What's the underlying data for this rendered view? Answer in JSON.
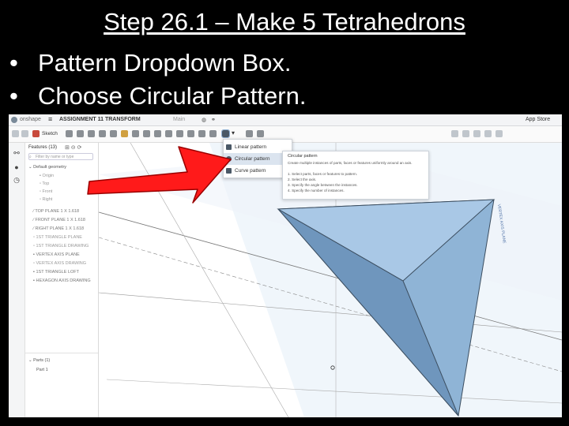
{
  "slide": {
    "title": "Step 26.1 – Make 5 Tetrahedrons",
    "bullets": [
      {
        "marker": "•",
        "text": "Pattern Dropdown Box."
      },
      {
        "marker": "•",
        "text": "Choose Circular Pattern."
      }
    ]
  },
  "app": {
    "brand": "onshape",
    "document_title": "ASSIGNMENT 11 TRANSFORM",
    "branch": "Main",
    "app_store": "App Store",
    "toolbar": {
      "sketch_label": "Sketch"
    },
    "features_panel": {
      "header": "Features (13)",
      "filter_placeholder": "Filter by name or type",
      "default_geometry": "Default geometry",
      "geometry_items": [
        "Origin",
        "Top",
        "Front",
        "Right"
      ],
      "features": [
        "TOP PLANE 1 X 1.618",
        "FRONT PLANE 1 X 1.618",
        "RIGHT PLANE 1 X 1.618",
        "1ST TRIANGLE PLANE",
        "1ST TRIANGLE DRAWING",
        "VERTEX AXIS PLANE",
        "VERTEX AXIS DRAWING",
        "1ST TRIANGLE LOFT",
        "HEXAGON AXIS DRAWING"
      ],
      "parts_header": "Parts (1)",
      "parts": [
        "Part 1"
      ]
    },
    "pattern_menu": {
      "items": [
        "Linear pattern",
        "Circular pattern",
        "Curve pattern"
      ],
      "active_index": 1
    },
    "tooltip": {
      "title": "Circular pattern",
      "description": "Create multiple instances of parts, faces or features uniformly around an axis.",
      "steps": [
        "1. Select parts, faces or features to pattern.",
        "2. Select the axis.",
        "3. Specify the angle between the instances.",
        "4. Specify the number of instances."
      ]
    },
    "viewport": {
      "plane_label": "VERTEX AXIS PLANE"
    }
  },
  "colors": {
    "arrow": "#ff1a1a",
    "tetrahedron_light": "#9ec3e6",
    "tetrahedron_dark": "#6f96bd",
    "plane": "#d9e6f2",
    "menu_highlight": "#dbe4ef"
  }
}
